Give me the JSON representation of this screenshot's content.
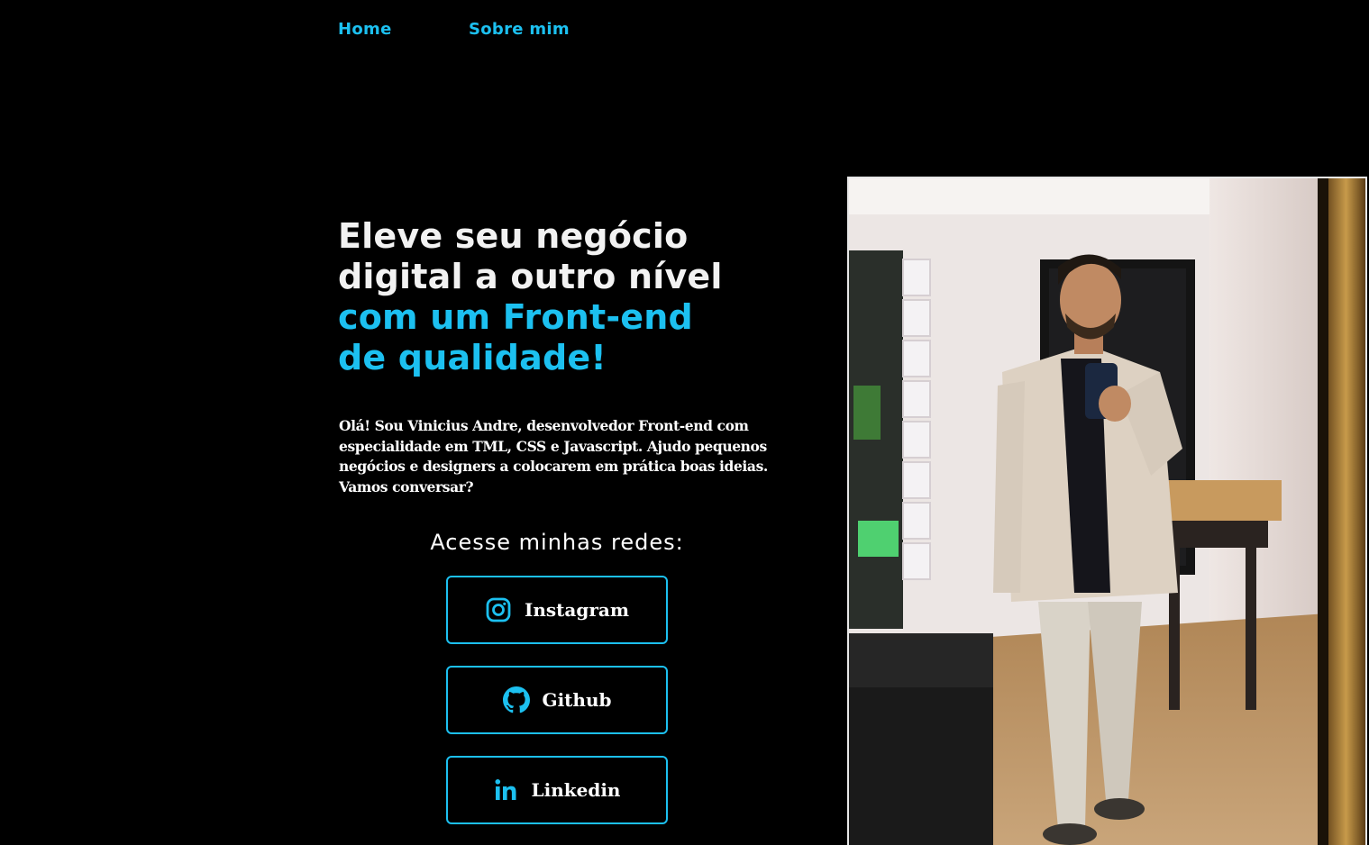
{
  "nav": {
    "items": [
      {
        "label": "Home"
      },
      {
        "label": "Sobre mim"
      }
    ]
  },
  "hero": {
    "title_lines": [
      "Eleve seu negócio",
      "digital a outro nível",
      "com um Front-end",
      "de qualidade!"
    ],
    "intro": "Olá! Sou Vinicius Andre, desenvolvedor Front-end com especialidade em TML, CSS e Javascript. Ajudo pequenos negócios e designers a colocarem em prática boas ideias. Vamos conversar?"
  },
  "social": {
    "heading": "Acesse minhas redes:",
    "links": [
      {
        "label": "Instagram",
        "icon": "instagram-icon"
      },
      {
        "label": "Github",
        "icon": "github-icon"
      },
      {
        "label": "Linkedin",
        "icon": "linkedin-icon"
      }
    ]
  },
  "colors": {
    "background": "#000000",
    "accent": "#1cc0f0",
    "text": "#ffffff"
  }
}
